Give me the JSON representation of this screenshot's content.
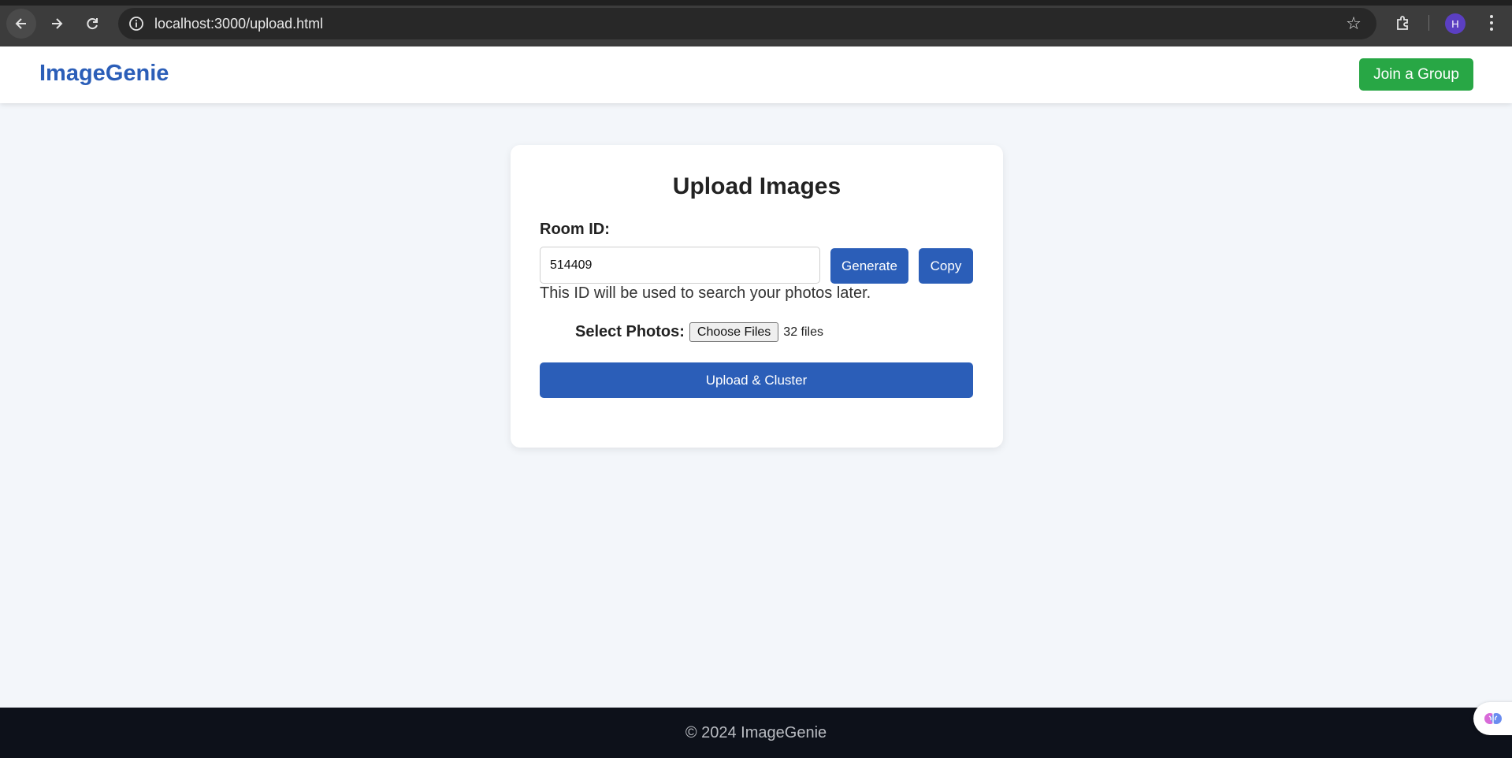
{
  "browser": {
    "url": "localhost:3000/upload.html",
    "profile_initial": "H",
    "icons": {
      "back": "arrow-left-icon",
      "forward": "arrow-right-icon",
      "reload": "reload-icon",
      "site_info": "info-icon",
      "bookmark": "star-icon",
      "extensions": "puzzle-icon",
      "menu": "kebab-menu-icon"
    }
  },
  "header": {
    "logo": "ImageGenie",
    "join_button": "Join a Group"
  },
  "upload_card": {
    "title": "Upload Images",
    "room_label": "Room ID:",
    "room_value": "514409",
    "generate_button": "Generate",
    "copy_button": "Copy",
    "hint": "This ID will be used to search your photos later.",
    "photos_label": "Select Photos:",
    "choose_files_button": "Choose Files",
    "file_count": "32 files",
    "upload_button": "Upload & Cluster"
  },
  "footer": {
    "text": "© 2024 ImageGenie"
  },
  "colors": {
    "brand_blue": "#2b5eb8",
    "join_green": "#28a745",
    "page_bg": "#f3f6fa",
    "footer_bg": "#0d111a"
  }
}
